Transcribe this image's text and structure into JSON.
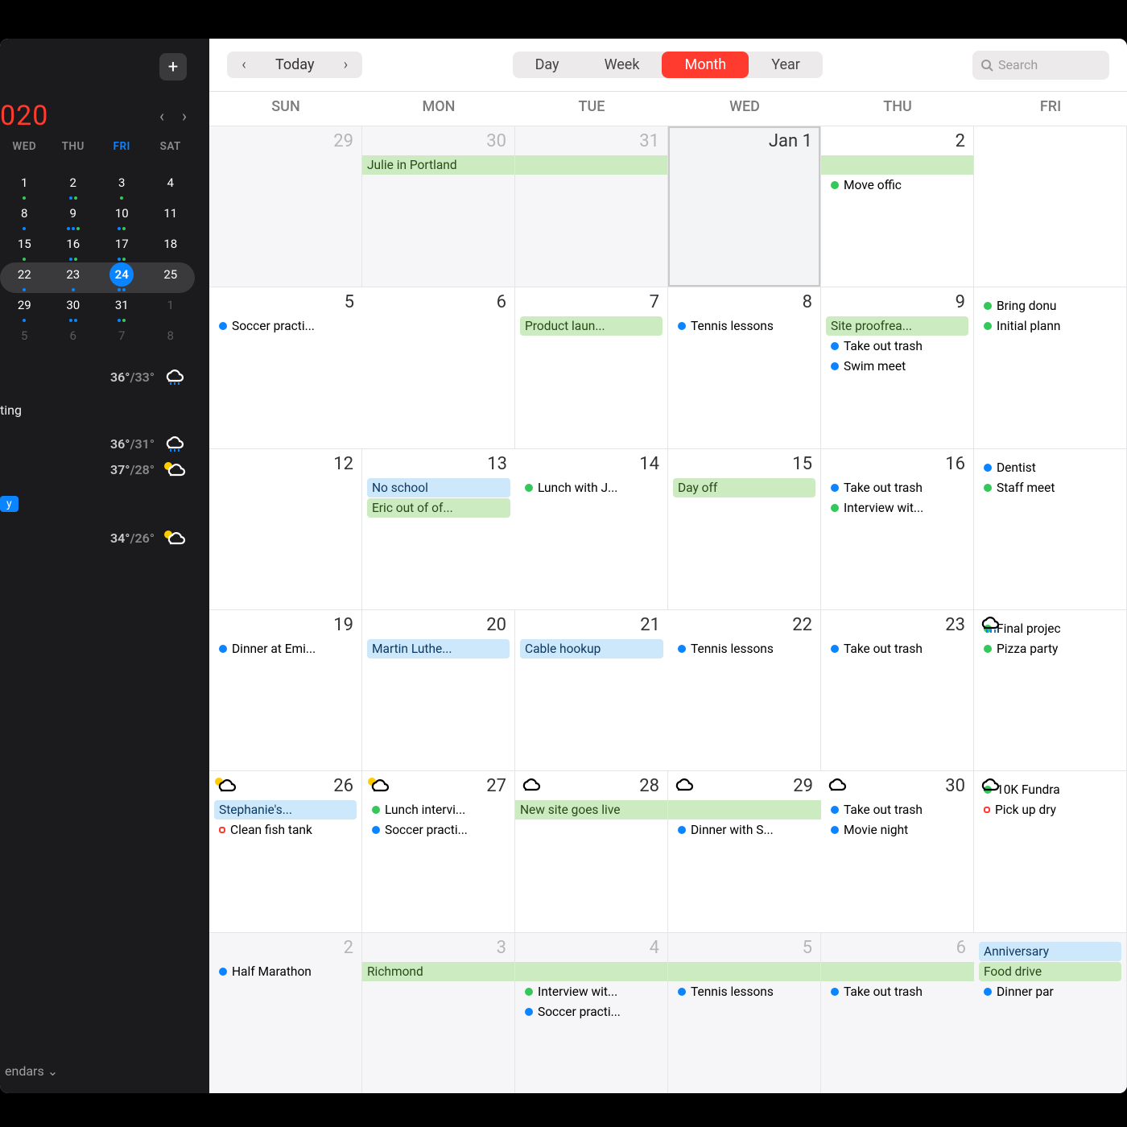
{
  "toolbar": {
    "today": "Today",
    "views": {
      "day": "Day",
      "week": "Week",
      "month": "Month",
      "year": "Year"
    },
    "active_view": "month",
    "search_placeholder": "Search"
  },
  "sidebar": {
    "year": "020",
    "mini_headers": [
      "WED",
      "THU",
      "FRI",
      "SAT"
    ],
    "today": 24,
    "calendars_label": "endars",
    "weather": [
      {
        "hi": "36°",
        "lo": "/33°"
      },
      {
        "hi": "36°",
        "lo": "/31°"
      },
      {
        "hi": "37°",
        "lo": "/28°"
      },
      {
        "hi": "34°",
        "lo": "/26°"
      }
    ],
    "item1": "ting",
    "tag": "y"
  },
  "weekdays": [
    "SUN",
    "MON",
    "TUE",
    "WED",
    "THU",
    "FRI"
  ],
  "cells": [
    {
      "d": "29",
      "off": true,
      "events": []
    },
    {
      "d": "30",
      "off": true,
      "events": [
        {
          "type": "bar-g",
          "t": "Julie in Portland",
          "span": true
        }
      ]
    },
    {
      "d": "31",
      "off": true,
      "events": [
        {
          "type": "bar-g",
          "t": "",
          "span": true
        }
      ]
    },
    {
      "d": "Jan 1",
      "today": true,
      "events": []
    },
    {
      "d": "2",
      "events": [
        {
          "type": "bar-g",
          "t": "",
          "span": true
        },
        {
          "type": "dot",
          "c": "g",
          "t": "Move offic"
        }
      ]
    },
    {
      "d": "",
      "events": []
    },
    {
      "d": "5",
      "events": [
        {
          "type": "dot",
          "c": "b",
          "t": "Soccer practi..."
        }
      ]
    },
    {
      "d": "6",
      "events": []
    },
    {
      "d": "7",
      "events": [
        {
          "type": "bar-g",
          "t": "Product laun..."
        }
      ]
    },
    {
      "d": "8",
      "events": [
        {
          "type": "dot",
          "c": "b",
          "t": "Tennis lessons"
        }
      ]
    },
    {
      "d": "9",
      "events": [
        {
          "type": "bar-g",
          "t": "Site proofrea..."
        },
        {
          "type": "dot",
          "c": "b",
          "t": "Take out trash"
        },
        {
          "type": "dot",
          "c": "b",
          "t": "Swim meet"
        }
      ]
    },
    {
      "d": "",
      "events": [
        {
          "type": "dot",
          "c": "g",
          "t": "Bring donu"
        },
        {
          "type": "dot",
          "c": "g",
          "t": "Initial plann"
        }
      ]
    },
    {
      "d": "12",
      "events": []
    },
    {
      "d": "13",
      "events": [
        {
          "type": "bar-b",
          "t": "No school"
        },
        {
          "type": "bar-g",
          "t": "Eric out of of..."
        }
      ]
    },
    {
      "d": "14",
      "events": [
        {
          "type": "dot",
          "c": "g",
          "t": "Lunch with J..."
        }
      ]
    },
    {
      "d": "15",
      "events": [
        {
          "type": "bar-g",
          "t": "Day off"
        }
      ]
    },
    {
      "d": "16",
      "events": [
        {
          "type": "dot",
          "c": "b",
          "t": "Take out trash"
        },
        {
          "type": "dot",
          "c": "g",
          "t": "Interview wit..."
        }
      ]
    },
    {
      "d": "",
      "events": [
        {
          "type": "dot",
          "c": "b",
          "t": "Dentist"
        },
        {
          "type": "dot",
          "c": "g",
          "t": "Staff meet"
        }
      ]
    },
    {
      "d": "19",
      "events": [
        {
          "type": "dot",
          "c": "b",
          "t": "Dinner at Emi..."
        }
      ]
    },
    {
      "d": "20",
      "events": [
        {
          "type": "bar-b",
          "t": "Martin Luthe..."
        }
      ]
    },
    {
      "d": "21",
      "events": [
        {
          "type": "bar-b",
          "t": "Cable hookup"
        }
      ]
    },
    {
      "d": "22",
      "events": [
        {
          "type": "dot",
          "c": "b",
          "t": "Tennis lessons"
        }
      ]
    },
    {
      "d": "23",
      "events": [
        {
          "type": "dot",
          "c": "b",
          "t": "Take out trash"
        }
      ]
    },
    {
      "d": "",
      "weather": "rain",
      "events": [
        {
          "type": "dot",
          "c": "g",
          "t": "Final projec"
        },
        {
          "type": "dot",
          "c": "g",
          "t": "Pizza party"
        }
      ]
    },
    {
      "d": "26",
      "weather": "sun",
      "events": [
        {
          "type": "bar-b",
          "t": "Stephanie's..."
        },
        {
          "type": "dot",
          "c": "r",
          "t": "Clean fish tank"
        }
      ]
    },
    {
      "d": "27",
      "weather": "sun",
      "events": [
        {
          "type": "dot",
          "c": "g",
          "t": "Lunch intervi..."
        },
        {
          "type": "dot",
          "c": "b",
          "t": "Soccer practi..."
        }
      ]
    },
    {
      "d": "28",
      "weather": "cloud",
      "events": [
        {
          "type": "bar-g",
          "t": "New site goes live",
          "span": true
        }
      ]
    },
    {
      "d": "29",
      "weather": "cloud",
      "events": [
        {
          "type": "bar-g",
          "t": "",
          "span": true
        },
        {
          "type": "dot",
          "c": "b",
          "t": "Dinner with S..."
        }
      ]
    },
    {
      "d": "30",
      "weather": "cloud",
      "events": [
        {
          "type": "dot",
          "c": "b",
          "t": "Take out trash"
        },
        {
          "type": "dot",
          "c": "b",
          "t": "Movie night"
        }
      ]
    },
    {
      "d": "",
      "weather": "cloud",
      "events": [
        {
          "type": "dot",
          "c": "g",
          "t": "10K Fundra"
        },
        {
          "type": "dot",
          "c": "r",
          "t": "Pick up dry"
        }
      ]
    },
    {
      "d": "2",
      "off": true,
      "events": [
        {
          "type": "dot",
          "c": "b",
          "t": "Half Marathon"
        }
      ]
    },
    {
      "d": "3",
      "off": true,
      "events": [
        {
          "type": "bar-g",
          "t": "Richmond",
          "span": true
        }
      ]
    },
    {
      "d": "4",
      "off": true,
      "events": [
        {
          "type": "bar-g",
          "t": "",
          "span": true
        },
        {
          "type": "dot",
          "c": "g",
          "t": "Interview wit..."
        },
        {
          "type": "dot",
          "c": "b",
          "t": "Soccer practi..."
        }
      ]
    },
    {
      "d": "5",
      "off": true,
      "events": [
        {
          "type": "bar-g",
          "t": "",
          "span": true
        },
        {
          "type": "dot",
          "c": "b",
          "t": "Tennis lessons"
        }
      ]
    },
    {
      "d": "6",
      "off": true,
      "events": [
        {
          "type": "bar-g",
          "t": "",
          "span": true
        },
        {
          "type": "dot",
          "c": "b",
          "t": "Take out trash"
        }
      ]
    },
    {
      "d": "",
      "off": true,
      "events": [
        {
          "type": "bar-b",
          "t": "Anniversary"
        },
        {
          "type": "bar-g",
          "t": "Food drive"
        },
        {
          "type": "dot",
          "c": "b",
          "t": "Dinner par"
        }
      ]
    }
  ],
  "mini": [
    [
      {
        "n": "1",
        "d": "g"
      },
      {
        "n": "2",
        "d": "bg"
      },
      {
        "n": "3",
        "d": "g"
      },
      {
        "n": "4"
      }
    ],
    [
      {
        "n": "8",
        "d": "b"
      },
      {
        "n": "9",
        "d": "bbg"
      },
      {
        "n": "10",
        "d": "bg"
      },
      {
        "n": "11"
      }
    ],
    [
      {
        "n": "15",
        "d": "g"
      },
      {
        "n": "16",
        "d": "bg"
      },
      {
        "n": "17",
        "d": "bg"
      },
      {
        "n": "18"
      }
    ],
    [
      {
        "n": "22",
        "d": "b"
      },
      {
        "n": "23",
        "d": "b"
      },
      {
        "n": "24",
        "today": true,
        "d": "bb"
      },
      {
        "n": "25"
      }
    ],
    [
      {
        "n": "29",
        "d": "b"
      },
      {
        "n": "30",
        "d": "bb"
      },
      {
        "n": "31",
        "d": "bg"
      },
      {
        "n": "1",
        "faded": true
      }
    ],
    [
      {
        "n": "5",
        "faded": true
      },
      {
        "n": "6",
        "faded": true
      },
      {
        "n": "7",
        "faded": true
      },
      {
        "n": "8",
        "faded": true
      }
    ]
  ]
}
